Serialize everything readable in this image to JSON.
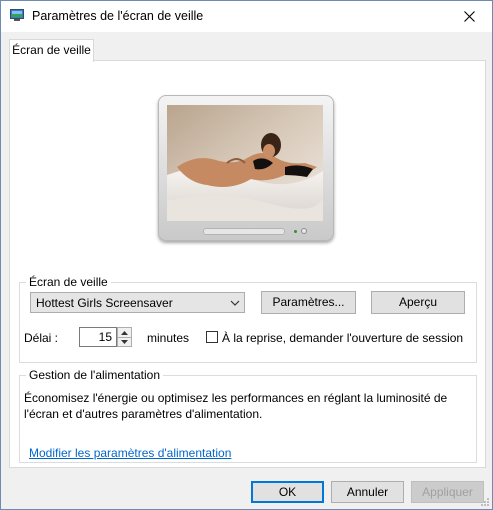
{
  "window": {
    "title": "Paramètres de l'écran de veille",
    "icon": "screensaver-monitor-icon"
  },
  "tab": {
    "label": "Écran de veille"
  },
  "screensaver": {
    "legend": "Écran de veille",
    "selected": "Hottest Girls Screensaver",
    "settings_label": "Paramètres...",
    "preview_label": "Aperçu",
    "delay_label": "Délai :",
    "delay_value": "15",
    "minutes_label": "minutes",
    "resume_label": "À la reprise, demander l'ouverture de session",
    "resume_checked": false
  },
  "power": {
    "legend": "Gestion de l'alimentation",
    "description_line1": "Économisez l'énergie ou optimisez les performances en réglant la luminosité de",
    "description_line2": "l'écran et d'autres paramètres d'alimentation.",
    "link_label": "Modifier les paramètres d'alimentation"
  },
  "footer": {
    "ok_label": "OK",
    "cancel_label": "Annuler",
    "apply_label": "Appliquer",
    "apply_enabled": false
  },
  "colors": {
    "accent": "#0078d7",
    "link": "#0066cc"
  }
}
